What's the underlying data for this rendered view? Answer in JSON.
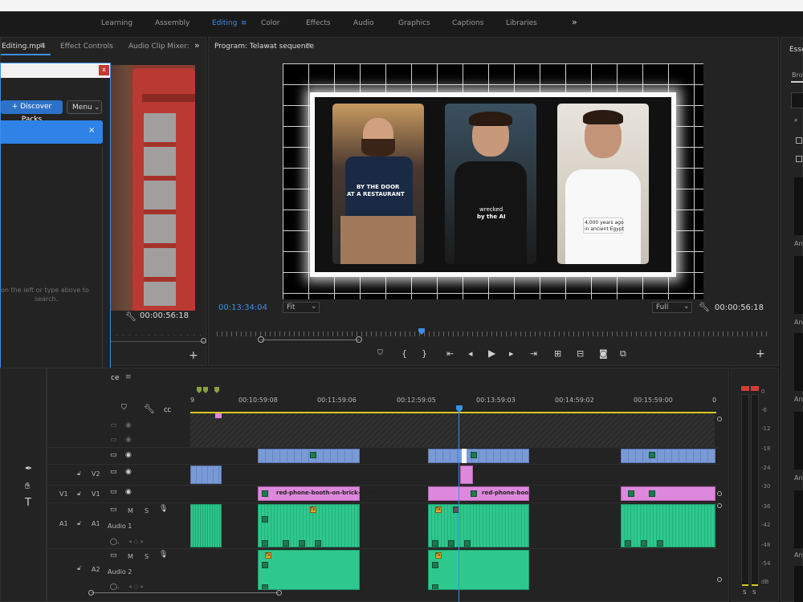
{
  "workspaces": [
    "Learning",
    "Assembly",
    "Editing",
    "Color",
    "Effects",
    "Audio",
    "Graphics",
    "Captions",
    "Libraries"
  ],
  "workspace_overflow": "»",
  "source_panel": {
    "tab_active": "Editing.mp4",
    "tab_menu": "≡",
    "tab_effect_controls": "Effect Controls",
    "tab_audio_mixer": "Audio Clip Mixer:",
    "overflow": "»",
    "timecode": "00:00:56:18"
  },
  "dialog": {
    "close": "x",
    "discover_button": "+ Discover Packs",
    "menu_button": "Menu",
    "search_hint_line1": "on the left or type above to",
    "search_hint_line2": "search."
  },
  "program": {
    "title": "Program: Telawat sequence",
    "menu": "≡",
    "timecode_left": "00:13:34:04",
    "fit_label": "Fit",
    "full_label": "Full",
    "timecode_right": "00:00:56:18",
    "caption1_l1": "BY THE  DOOR",
    "caption1_l2": "AT A RESTAURANT",
    "caption2_l1": "wrecked",
    "caption2_l2": "by the AI",
    "caption3_l1": "4,000 years ago",
    "caption3_l2": "in ancient Egypt"
  },
  "essentials": {
    "tab": "Esse",
    "sub": "Brow",
    "labels": [
      "An",
      "An",
      "An",
      "An",
      "An"
    ]
  },
  "timeline": {
    "tab": "ce",
    "ruler": [
      "9",
      "00:10:59:08",
      "00:11:59:06",
      "00:12:59:05",
      "00:13:59:03",
      "00:14:59:02",
      "00:15:59:00",
      "0"
    ],
    "tracks": {
      "v2_name": "V2",
      "v1_src": "V1",
      "v1_name": "V1",
      "a1_src": "A1",
      "a1_name": "A1",
      "a1_label": "Audio 1",
      "a2_name": "A2",
      "a2_label": "Audio 2"
    },
    "clip_v1a": "red-phone-booth-on-brick-260nw-",
    "clip_v1b": "red-phone-booth-o"
  },
  "meter": {
    "scale": [
      "0",
      "-6",
      "-12",
      "-18",
      "-24",
      "-30",
      "-36",
      "-42",
      "-48",
      "-54",
      "dB"
    ],
    "solo": "S"
  },
  "colors": {
    "accent": "#3d8ee6",
    "video_clip": "#7a9ad6",
    "fx_clip": "#dd88dc",
    "audio_clip": "#2ec88e"
  }
}
